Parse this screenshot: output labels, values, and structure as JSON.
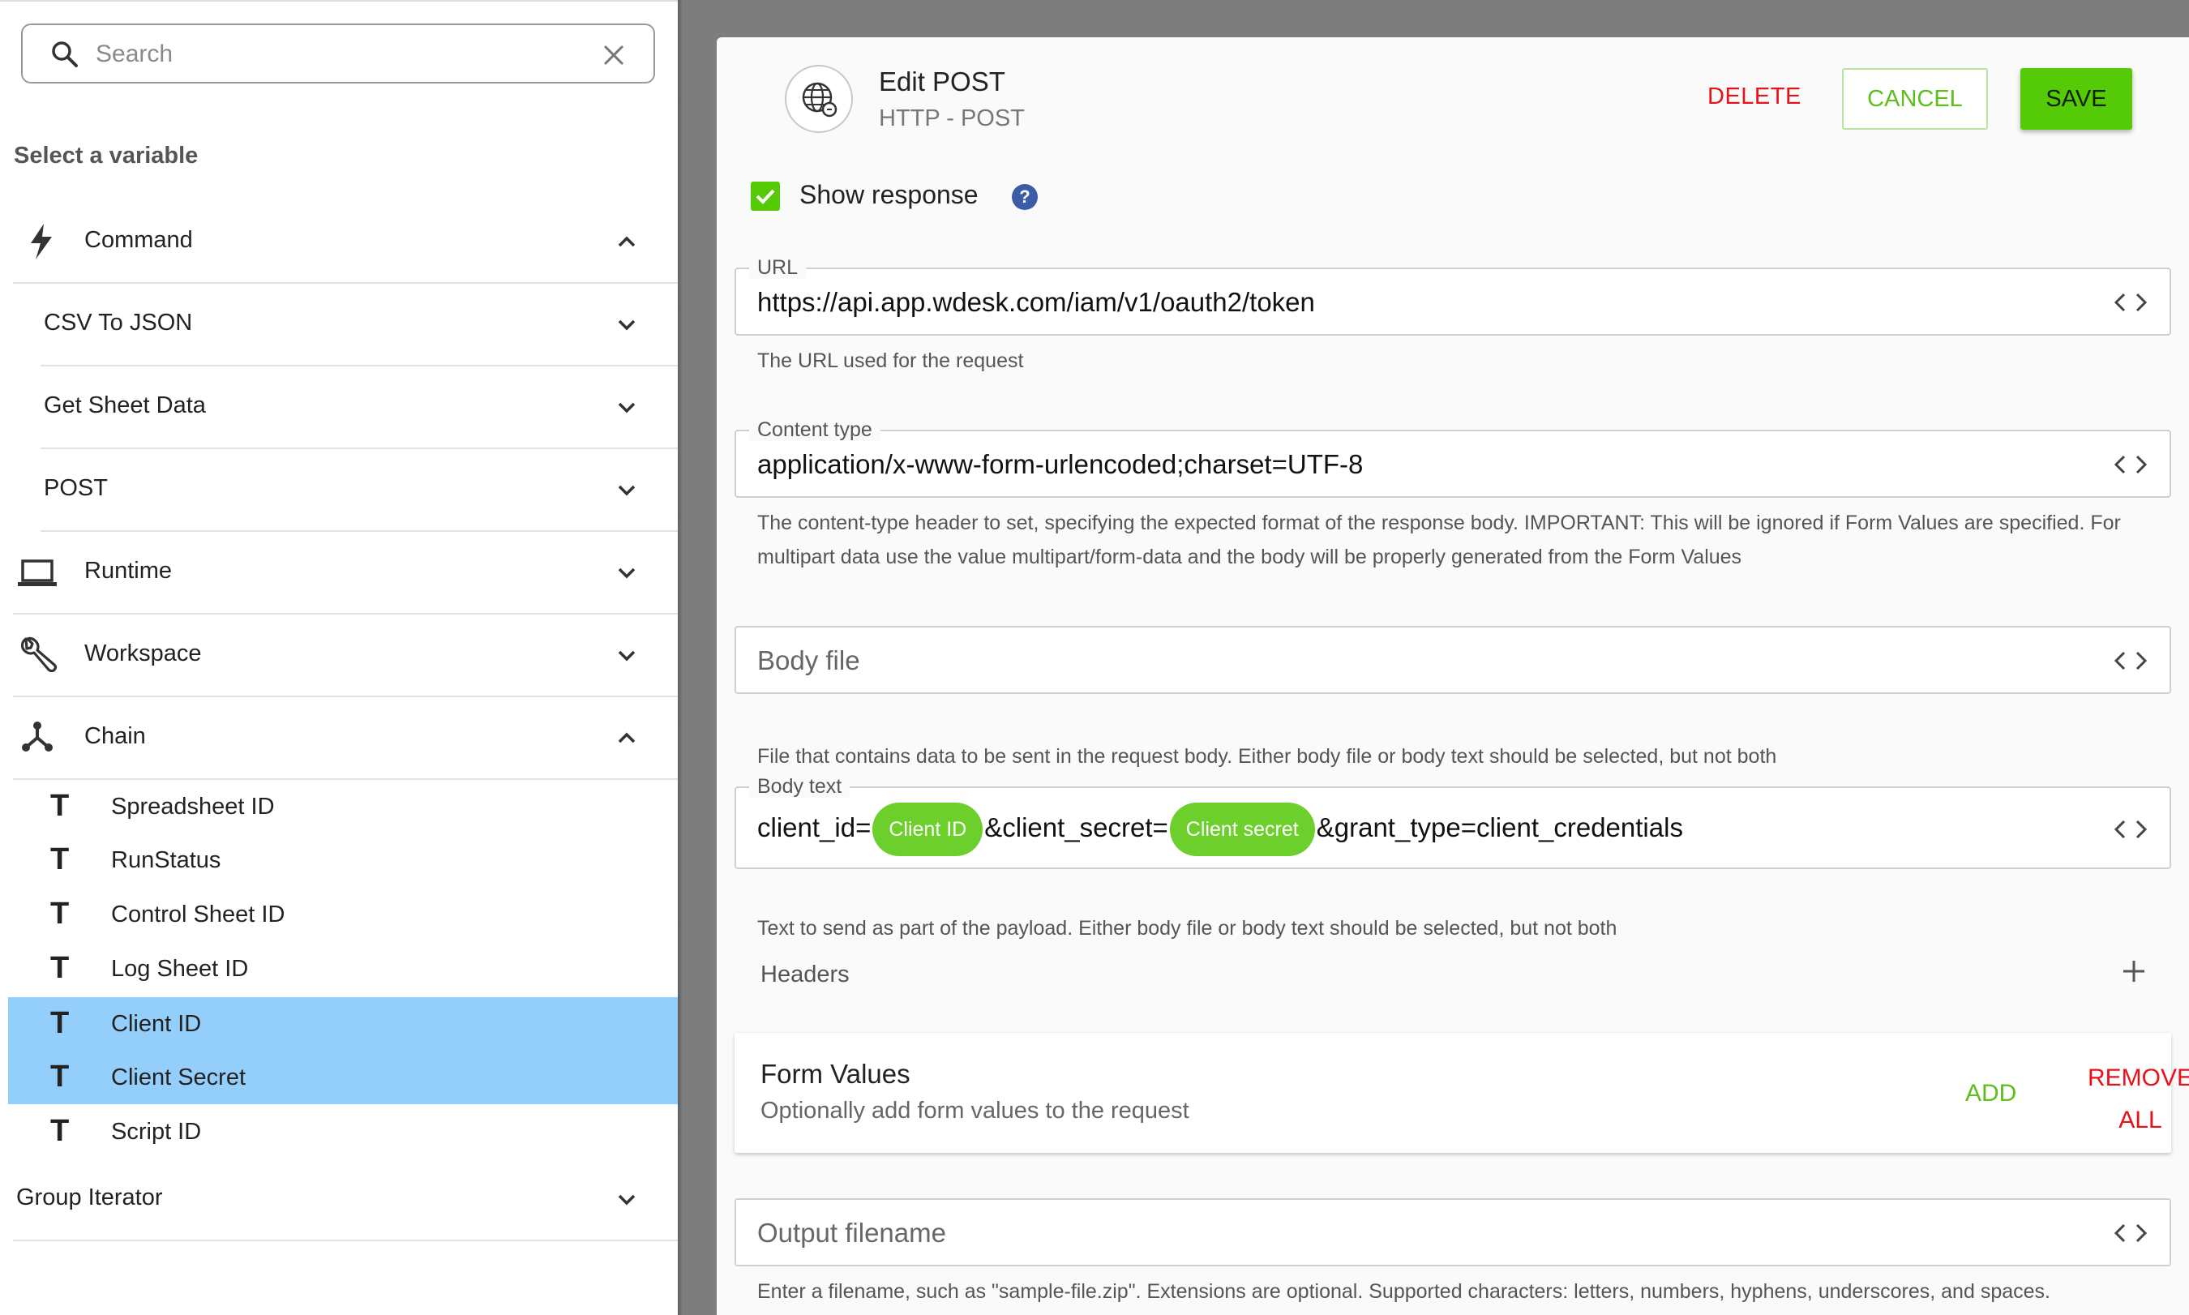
{
  "search": {
    "placeholder": "Search"
  },
  "sidebar": {
    "section_title": "Select a variable",
    "groups": [
      {
        "label": "Command",
        "icon": "bolt-icon",
        "expanded": true
      },
      {
        "label": "CSV To JSON",
        "expanded": false
      },
      {
        "label": "Get Sheet Data",
        "expanded": false
      },
      {
        "label": "POST",
        "expanded": false
      },
      {
        "label": "Runtime",
        "icon": "laptop-icon",
        "expanded": false
      },
      {
        "label": "Workspace",
        "icon": "wrench-icon",
        "expanded": false
      },
      {
        "label": "Chain",
        "icon": "chain-icon",
        "expanded": true
      },
      {
        "label": "Group Iterator",
        "expanded": false
      }
    ],
    "chain_items": [
      {
        "type": "T",
        "label": "Spreadsheet ID",
        "selected": false
      },
      {
        "type": "T",
        "label": "RunStatus",
        "selected": false
      },
      {
        "type": "T",
        "label": "Control Sheet ID",
        "selected": false
      },
      {
        "type": "T",
        "label": "Log Sheet ID",
        "selected": false
      },
      {
        "type": "T",
        "label": "Client ID",
        "selected": true
      },
      {
        "type": "T",
        "label": "Client Secret",
        "selected": true
      },
      {
        "type": "T",
        "label": "Script ID",
        "selected": false
      }
    ]
  },
  "editor": {
    "title": "Edit POST",
    "subtitle": "HTTP - POST",
    "delete_label": "DELETE",
    "cancel_label": "CANCEL",
    "save_label": "SAVE",
    "show_response": {
      "label": "Show response",
      "checked": true,
      "help": "?"
    },
    "url": {
      "legend": "URL",
      "value": "https://api.app.wdesk.com/iam/v1/oauth2/token",
      "help": "The URL used for the request"
    },
    "content_type": {
      "legend": "Content type",
      "value": "application/x-www-form-urlencoded;charset=UTF-8",
      "help": "The content-type header to set, specifying the expected format of the response body. IMPORTANT: This will be ignored if Form Values are specified. For multipart data use the value multipart/form-data and the body will be properly generated from the Form Values"
    },
    "body_file": {
      "placeholder": "Body file",
      "help": "File that contains data to be sent in the request body. Either body file or body text should be selected, but not both"
    },
    "body_text": {
      "legend": "Body text",
      "part1": "client_id=",
      "chip1": "Client ID",
      "part2": "&client_secret=",
      "chip2": "Client secret",
      "part3": "&grant_type=client_credentials",
      "help": "Text to send as part of the payload. Either body file or body text should be selected, but not both"
    },
    "headers_label": "Headers",
    "form_values": {
      "title": "Form Values",
      "subtitle": "Optionally add form values to the request",
      "add_label": "ADD",
      "remove_line1": "REMOVE",
      "remove_line2": "ALL"
    },
    "output_filename": {
      "placeholder": "Output filename",
      "help": "Enter a filename, such as \"sample-file.zip\". Extensions are optional. Supported characters: letters, numbers, hyphens, underscores, and spaces."
    }
  },
  "colors": {
    "accent_green": "#55cb07",
    "danger_red": "#e8111a",
    "selection_blue": "#93cffa",
    "backdrop": "#7d7d7d"
  }
}
